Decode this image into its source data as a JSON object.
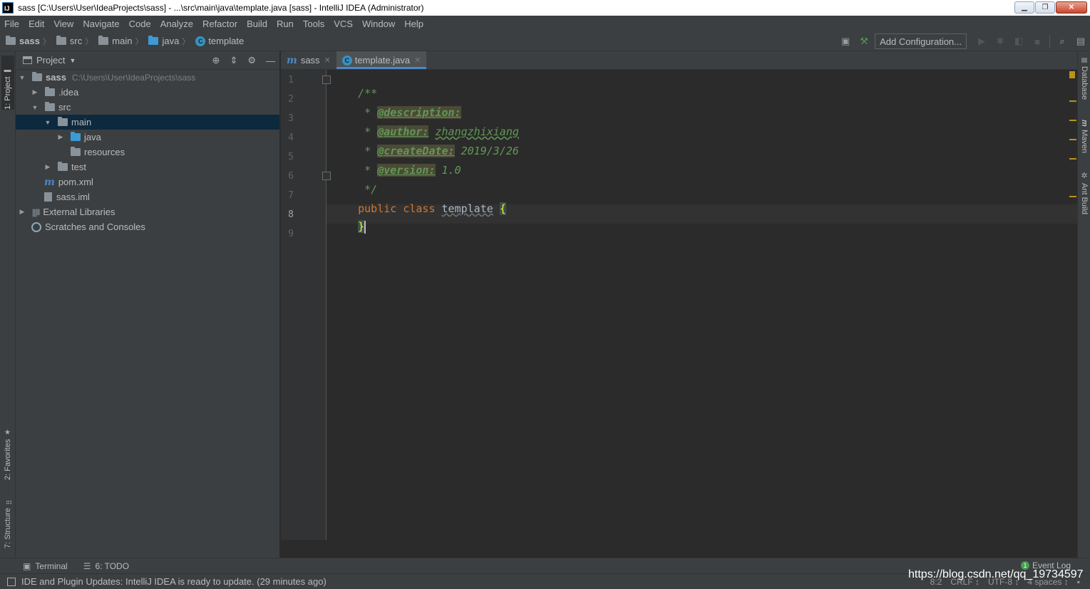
{
  "titlebar": {
    "app_icon": "IJ",
    "title": "sass [C:\\Users\\User\\IdeaProjects\\sass] - ...\\src\\main\\java\\template.java [sass] - IntelliJ IDEA (Administrator)",
    "minimize": "▁",
    "restore": "❐",
    "close": "✕"
  },
  "menu": [
    "File",
    "Edit",
    "View",
    "Navigate",
    "Code",
    "Analyze",
    "Refactor",
    "Build",
    "Run",
    "Tools",
    "VCS",
    "Window",
    "Help"
  ],
  "breadcrumb": [
    "sass",
    "src",
    "main",
    "java",
    "template"
  ],
  "toolbar": {
    "add_configuration": "Add Configuration...",
    "icons": [
      "project-structure-icon",
      "build-hammer-icon",
      "run-icon",
      "debug-icon",
      "coverage-icon",
      "stop-icon",
      "search-everywhere-icon",
      "sdk-icon"
    ]
  },
  "left_strip": {
    "project_tab": "1: Project",
    "favorites_tab": "2: Favorites",
    "structure_tab": "7: Structure"
  },
  "right_strip": {
    "database_tab": "Database",
    "maven_tab": "Maven",
    "ant_tab": "Ant Build"
  },
  "project_panel": {
    "title": "Project",
    "tree": [
      {
        "label": "sass",
        "path": "C:\\Users\\User\\IdeaProjects\\sass",
        "depth": 0,
        "expanded": true
      },
      {
        "label": ".idea",
        "depth": 1,
        "expanded": false
      },
      {
        "label": "src",
        "depth": 1,
        "expanded": true
      },
      {
        "label": "main",
        "depth": 2,
        "expanded": true,
        "selected": true
      },
      {
        "label": "java",
        "depth": 3,
        "expanded": false
      },
      {
        "label": "resources",
        "depth": 3
      },
      {
        "label": "test",
        "depth": 2,
        "expanded": false
      },
      {
        "label": "pom.xml",
        "depth": 1
      },
      {
        "label": "sass.iml",
        "depth": 1
      },
      {
        "label": "External Libraries",
        "depth": 0,
        "expanded": false
      },
      {
        "label": "Scratches and Consoles",
        "depth": 0
      }
    ]
  },
  "editor_tabs": [
    {
      "label": "sass",
      "active": false
    },
    {
      "label": "template.java",
      "active": true
    }
  ],
  "editor": {
    "line_numbers": [
      "1",
      "2",
      "3",
      "4",
      "5",
      "6",
      "7",
      "8",
      "9"
    ],
    "current_line": "8",
    "javadoc": {
      "open": "/**",
      "star": "*",
      "description_tag": "@description:",
      "author_tag": "@author:",
      "author_value": "zhangzhixiang",
      "createdate_tag": "@createDate:",
      "createdate_value": "2019/3/26",
      "version_tag": "@version:",
      "version_value": "1.0",
      "close": "*/"
    },
    "code": {
      "kw_public": "public",
      "kw_class": "class",
      "class_name": "template",
      "open_brace": "{",
      "close_brace": "}"
    }
  },
  "bottom_tools": {
    "terminal": "Terminal",
    "todo": "6: TODO",
    "event_log": "Event Log",
    "event_count": "1"
  },
  "status": {
    "message": "IDE and Plugin Updates: IntelliJ IDEA is ready to update. (29 minutes ago)",
    "position": "8:2",
    "line_separator": "CRLF ↕",
    "encoding": "UTF-8 ↕",
    "indent": "4 spaces ↕"
  },
  "watermark": "https://blog.csdn.net/qq_19734597",
  "colors": {
    "background": "#2b2b2b",
    "panel": "#3c3f41",
    "selection": "#0d293e",
    "keyword": "#cc7832",
    "comment": "#629755",
    "accent": "#4a88c7"
  }
}
